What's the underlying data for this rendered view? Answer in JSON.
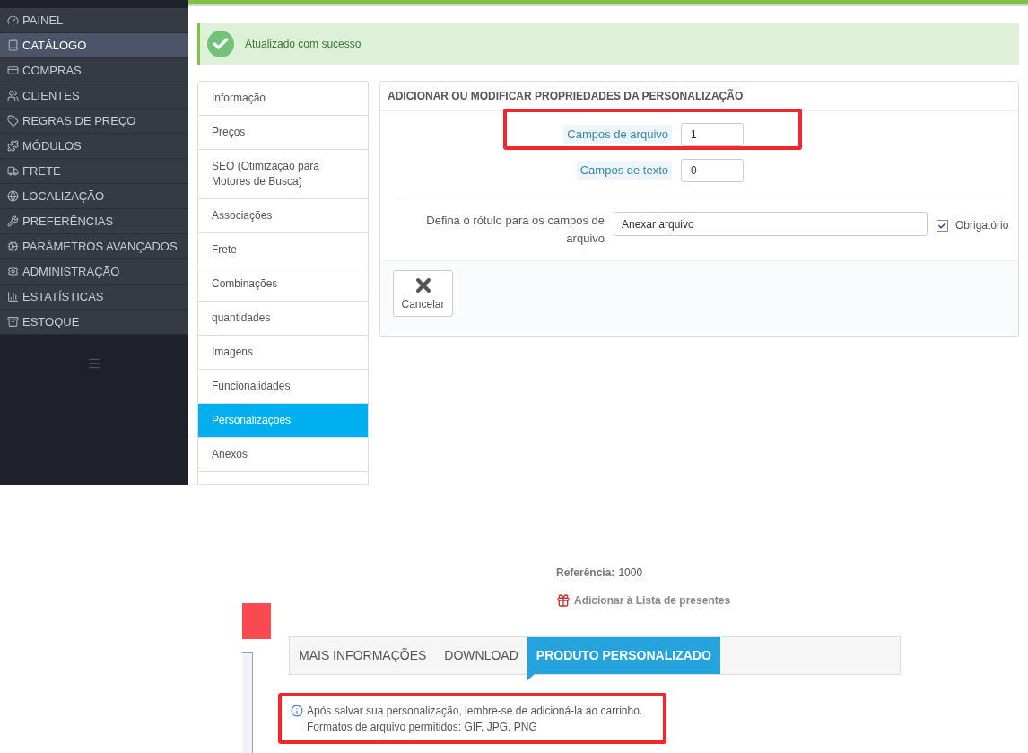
{
  "sidebar": {
    "items": [
      {
        "label": "PAINEL",
        "selected": false
      },
      {
        "label": "CATÁLOGO",
        "selected": true
      },
      {
        "label": "COMPRAS",
        "selected": false
      },
      {
        "label": "CLIENTES",
        "selected": false
      },
      {
        "label": "REGRAS DE PREÇO",
        "selected": false
      },
      {
        "label": "MÓDULOS",
        "selected": false
      },
      {
        "label": "FRETE",
        "selected": false
      },
      {
        "label": "LOCALIZAÇÃO",
        "selected": false
      },
      {
        "label": "PREFERÊNCIAS",
        "selected": false
      },
      {
        "label": "PARÂMETROS AVANÇADOS",
        "selected": false
      },
      {
        "label": "ADMINISTRAÇÃO",
        "selected": false
      },
      {
        "label": "ESTATÍSTICAS",
        "selected": false
      },
      {
        "label": "ESTOQUE",
        "selected": false
      }
    ]
  },
  "alert": {
    "message": "Atualizado com sucesso"
  },
  "product_tabs": [
    {
      "label": "Informação",
      "selected": false
    },
    {
      "label": "Preços",
      "selected": false
    },
    {
      "label": "SEO (Otimização para Motores de Busca)",
      "selected": false
    },
    {
      "label": "Associações",
      "selected": false
    },
    {
      "label": "Frete",
      "selected": false
    },
    {
      "label": "Combinações",
      "selected": false
    },
    {
      "label": "quantidades",
      "selected": false
    },
    {
      "label": "Imagens",
      "selected": false
    },
    {
      "label": "Funcionalidades",
      "selected": false
    },
    {
      "label": "Personalizações",
      "selected": true
    },
    {
      "label": "Anexos",
      "selected": false
    }
  ],
  "panel": {
    "title": "ADICIONAR OU MODIFICAR PROPRIEDADES DA PERSONALIZAÇÃO",
    "count_fields": [
      {
        "label": "Campos de arquivo",
        "value": "1",
        "highlighted": true
      },
      {
        "label": "Campos de texto",
        "value": "0",
        "highlighted": false
      }
    ],
    "label_field": {
      "label": "Defina o rótulo para os campos de arquivo",
      "value": "Anexar arquivo",
      "required_label": "Obrigatório",
      "required": true
    },
    "cancel_button": "Cancelar"
  },
  "front": {
    "reference_label": "Referência:",
    "reference_value": "1000",
    "gift_link": "Adicionar à Lista de presentes",
    "tabs": [
      {
        "label": "MAIS INFORMAÇÕES",
        "selected": false
      },
      {
        "label": "DOWNLOAD",
        "selected": false
      },
      {
        "label": "PRODUTO PERSONALIZADO",
        "selected": true
      }
    ],
    "info_lines": [
      "Após salvar sua personalização, lembre-se de adicioná-la ao carrinho.",
      "Formatos de arquivo permitidos: GIF, JPG, PNG"
    ]
  }
}
